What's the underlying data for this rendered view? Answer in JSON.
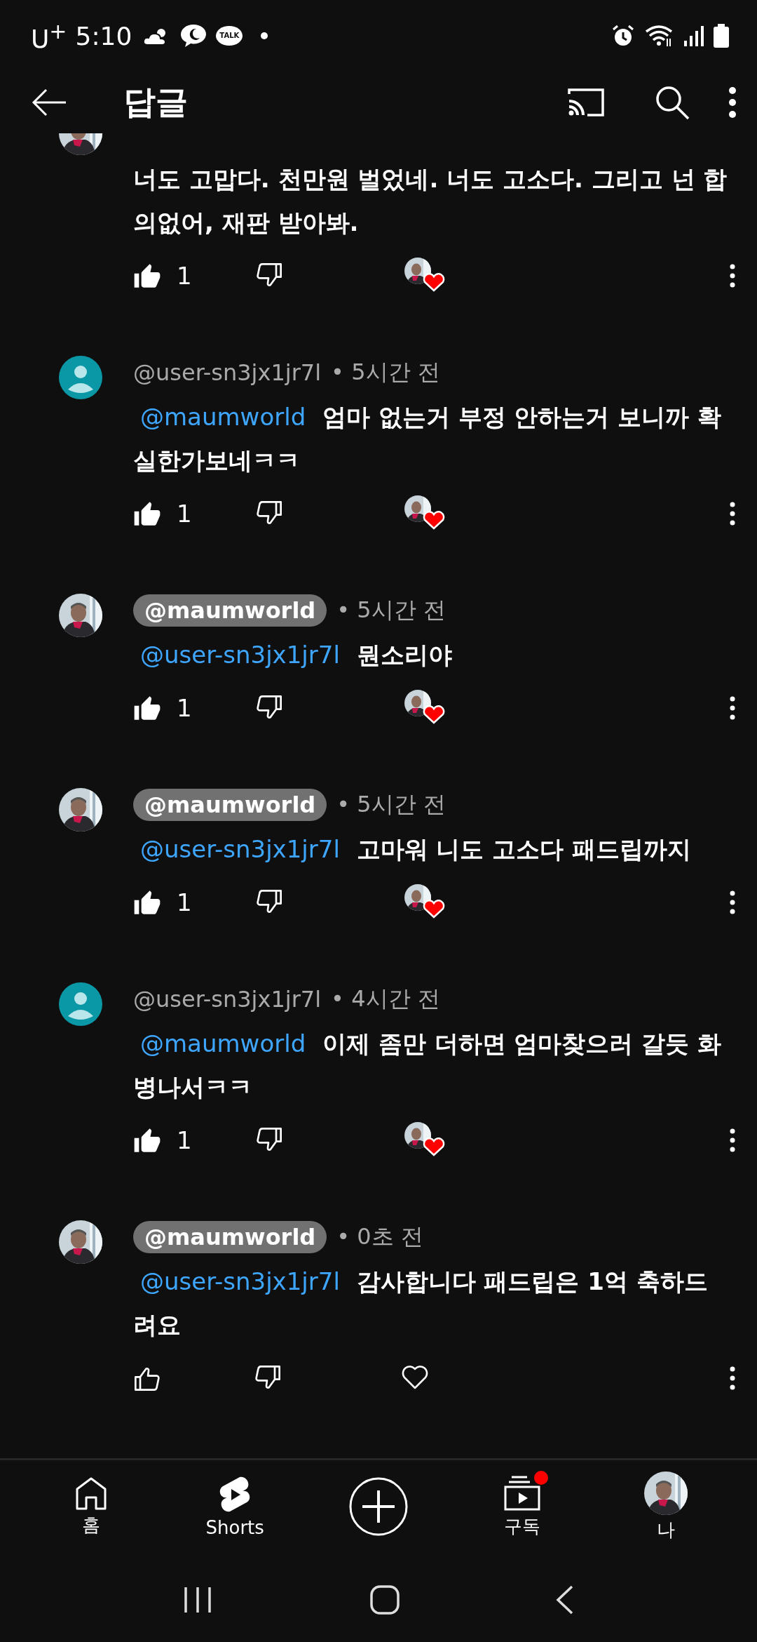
{
  "status_bar": {
    "carrier": "U$^{+}$",
    "time": "5:10",
    "notifications": [
      {
        "kind": "weather"
      },
      {
        "kind": "chat"
      },
      {
        "kind": "talk",
        "label": "TALK"
      },
      {
        "kind": "dot"
      }
    ]
  },
  "header": {
    "title": "답글"
  },
  "comments": [
    {
      "cut": true,
      "kind": "photo",
      "text": "너도 고맙다. 천만원 벌었네. 너도 고소다. 그리고 넌 합의없어, 재판 받아봐.",
      "likes": "1",
      "liked": true,
      "hearted": true
    },
    {
      "cut": false,
      "author": "@user-sn3jx1jr7l",
      "creator": false,
      "kind": "default",
      "time": "• 5시간 전",
      "mention": "@maumworld",
      "text": "엄마 없는거 부정 안하는거 보니까 확실한가보네ㅋㅋ",
      "likes": "1",
      "liked": true,
      "hearted": true
    },
    {
      "cut": false,
      "author": "@maumworld",
      "creator": true,
      "kind": "photo",
      "time": "• 5시간 전",
      "mention": "@user-sn3jx1jr7l",
      "text": "뭔소리야",
      "likes": "1",
      "liked": true,
      "hearted": true
    },
    {
      "cut": false,
      "author": "@maumworld",
      "creator": true,
      "kind": "photo",
      "time": "• 5시간 전",
      "mention": "@user-sn3jx1jr7l",
      "text": "고마워 니도 고소다 패드립까지",
      "likes": "1",
      "liked": true,
      "hearted": true
    },
    {
      "cut": false,
      "author": "@user-sn3jx1jr7l",
      "creator": false,
      "kind": "default",
      "time": "• 4시간 전",
      "mention": "@maumworld",
      "text": "이제 좀만 더하면 엄마찾으러 갈듯 화병나서ㅋㅋ",
      "likes": "1",
      "liked": true,
      "hearted": true
    },
    {
      "cut": false,
      "author": "@maumworld",
      "creator": true,
      "kind": "photo",
      "time": "• 0초 전",
      "mention": "@user-sn3jx1jr7l",
      "text": "감사합니다 패드립은 1억 축하드려요",
      "liked": false,
      "hearted": false
    }
  ],
  "bottom_nav": [
    {
      "kind": "home",
      "label": "홈",
      "notification": false
    },
    {
      "kind": "shorts",
      "label": "Shorts",
      "notification": false
    },
    {
      "kind": "create",
      "notification": false
    },
    {
      "kind": "subscriptions",
      "label": "구독",
      "notification": true
    },
    {
      "kind": "you",
      "label": "나",
      "notification": false
    }
  ]
}
